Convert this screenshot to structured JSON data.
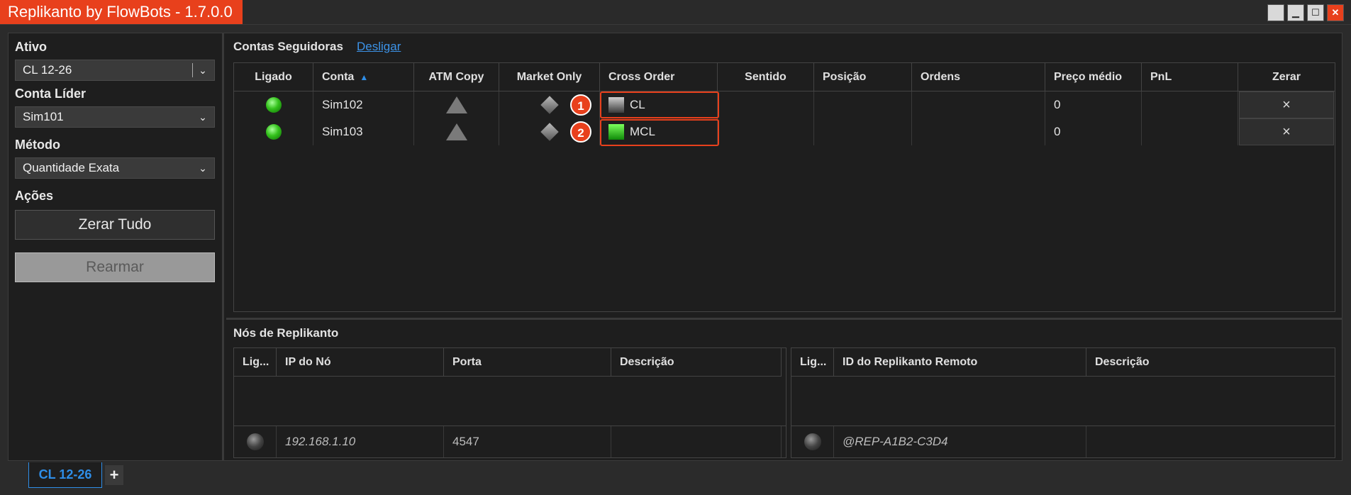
{
  "window": {
    "title": "Replikanto by FlowBots - 1.7.0.0",
    "controls": [
      "restore-icon",
      "minimize-icon",
      "maximize-icon",
      "close-icon"
    ]
  },
  "left_panel": {
    "ativo_label": "Ativo",
    "ativo_value": "CL 12-26",
    "conta_lider_label": "Conta Líder",
    "conta_lider_value": "Sim101",
    "metodo_label": "Método",
    "metodo_value": "Quantidade Exata",
    "acoes_label": "Ações",
    "zerar_tudo": "Zerar Tudo",
    "rearmar": "Rearmar"
  },
  "followers": {
    "title": "Contas Seguidoras",
    "disconnect_link": "Desligar",
    "columns": [
      "Ligado",
      "Conta",
      "ATM Copy",
      "Market Only",
      "Cross Order",
      "Sentido",
      "Posição",
      "Ordens",
      "Preço médio",
      "PnL",
      "Zerar"
    ],
    "rows": [
      {
        "ligado": "green-led-icon",
        "conta": "Sim102",
        "atm": "triangle-icon",
        "market": "diamond-icon",
        "badge": "1",
        "cross_icon": "grey-square-icon",
        "cross_order": "CL",
        "sentido": "",
        "posicao": "",
        "ordens": "",
        "preco_medio": "0",
        "pnl": "",
        "zerar": "×"
      },
      {
        "ligado": "green-led-icon",
        "conta": "Sim103",
        "atm": "triangle-icon",
        "market": "diamond-icon",
        "badge": "2",
        "cross_icon": "green-square-icon",
        "cross_order": "MCL",
        "sentido": "",
        "posicao": "",
        "ordens": "",
        "preco_medio": "0",
        "pnl": "",
        "zerar": "×"
      }
    ]
  },
  "nodes": {
    "title": "Nós de Replikanto",
    "local_columns": [
      "Lig...",
      "IP do Nó",
      "Porta",
      "Descrição"
    ],
    "local_row": {
      "ip": "192.168.1.10",
      "porta": "4547",
      "descricao": ""
    },
    "remote_columns": [
      "Lig...",
      "ID do Replikanto Remoto",
      "Descrição"
    ],
    "remote_row": {
      "id": "@REP-A1B2-C3D4",
      "descricao": ""
    }
  },
  "tabs": {
    "active": "CL 12-26",
    "add": "+"
  }
}
